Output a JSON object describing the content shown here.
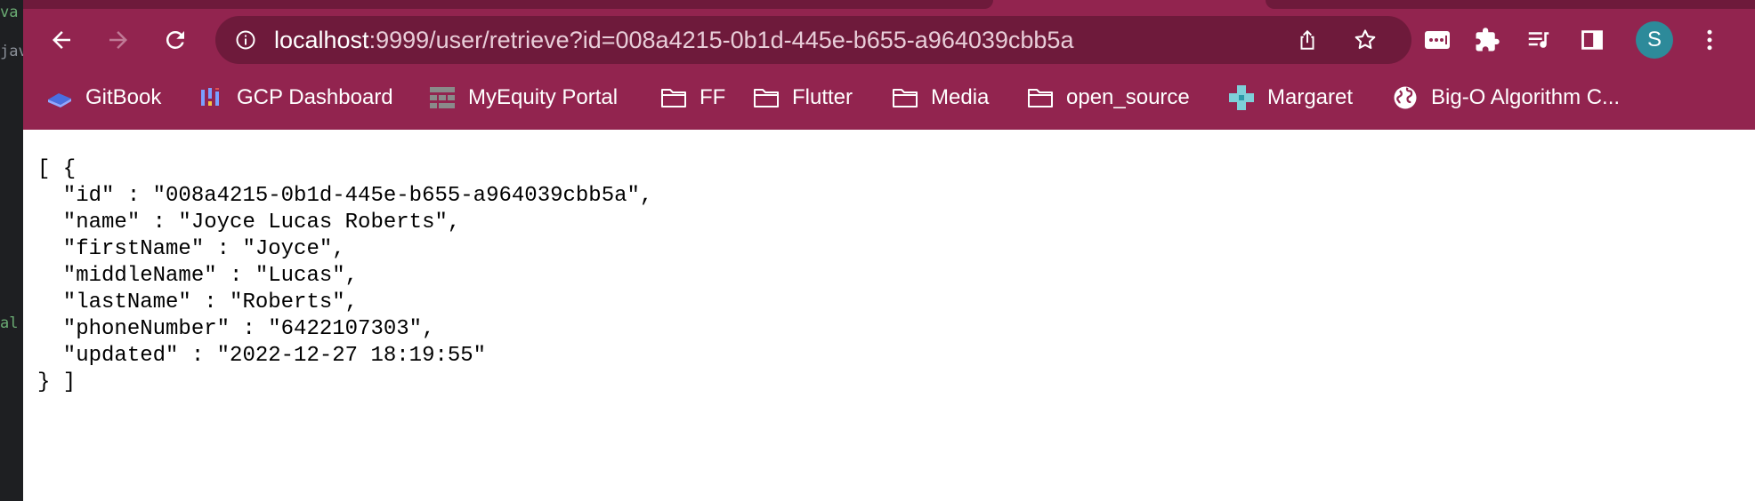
{
  "ide": {
    "fragments": [
      "va",
      "jav",
      "al"
    ]
  },
  "browser": {
    "colors": {
      "frame": "#92244f",
      "omnibox": "#6e1a3b",
      "avatar": "#2d8a9a"
    },
    "toolbar": {
      "url_host": "localhost",
      "url_rest": ":9999/user/retrieve?id=008a4215-0b1d-445e-b655-a964039cbb5a",
      "avatar_initial": "S"
    },
    "bookmarks": [
      {
        "label": "GitBook",
        "icon": "gitbook-icon"
      },
      {
        "label": "GCP Dashboard",
        "icon": "gcp-icon"
      },
      {
        "label": "MyEquity Portal",
        "icon": "grid-icon"
      },
      {
        "label": "FF",
        "icon": "folder-icon"
      },
      {
        "label": "Flutter",
        "icon": "folder-icon"
      },
      {
        "label": "Media",
        "icon": "folder-icon"
      },
      {
        "label": "open_source",
        "icon": "folder-icon"
      },
      {
        "label": "Margaret",
        "icon": "cross-icon"
      },
      {
        "label": "Big-O Algorithm C...",
        "icon": "globe-icon"
      }
    ]
  },
  "json_view": {
    "lines": [
      "[ {",
      "  \"id\" : \"008a4215-0b1d-445e-b655-a964039cbb5a\",",
      "  \"name\" : \"Joyce Lucas Roberts\",",
      "  \"firstName\" : \"Joyce\",",
      "  \"middleName\" : \"Lucas\",",
      "  \"lastName\" : \"Roberts\",",
      "  \"phoneNumber\" : \"6422107303\",",
      "  \"updated\" : \"2022-12-27 18:19:55\"",
      "} ]"
    ]
  }
}
